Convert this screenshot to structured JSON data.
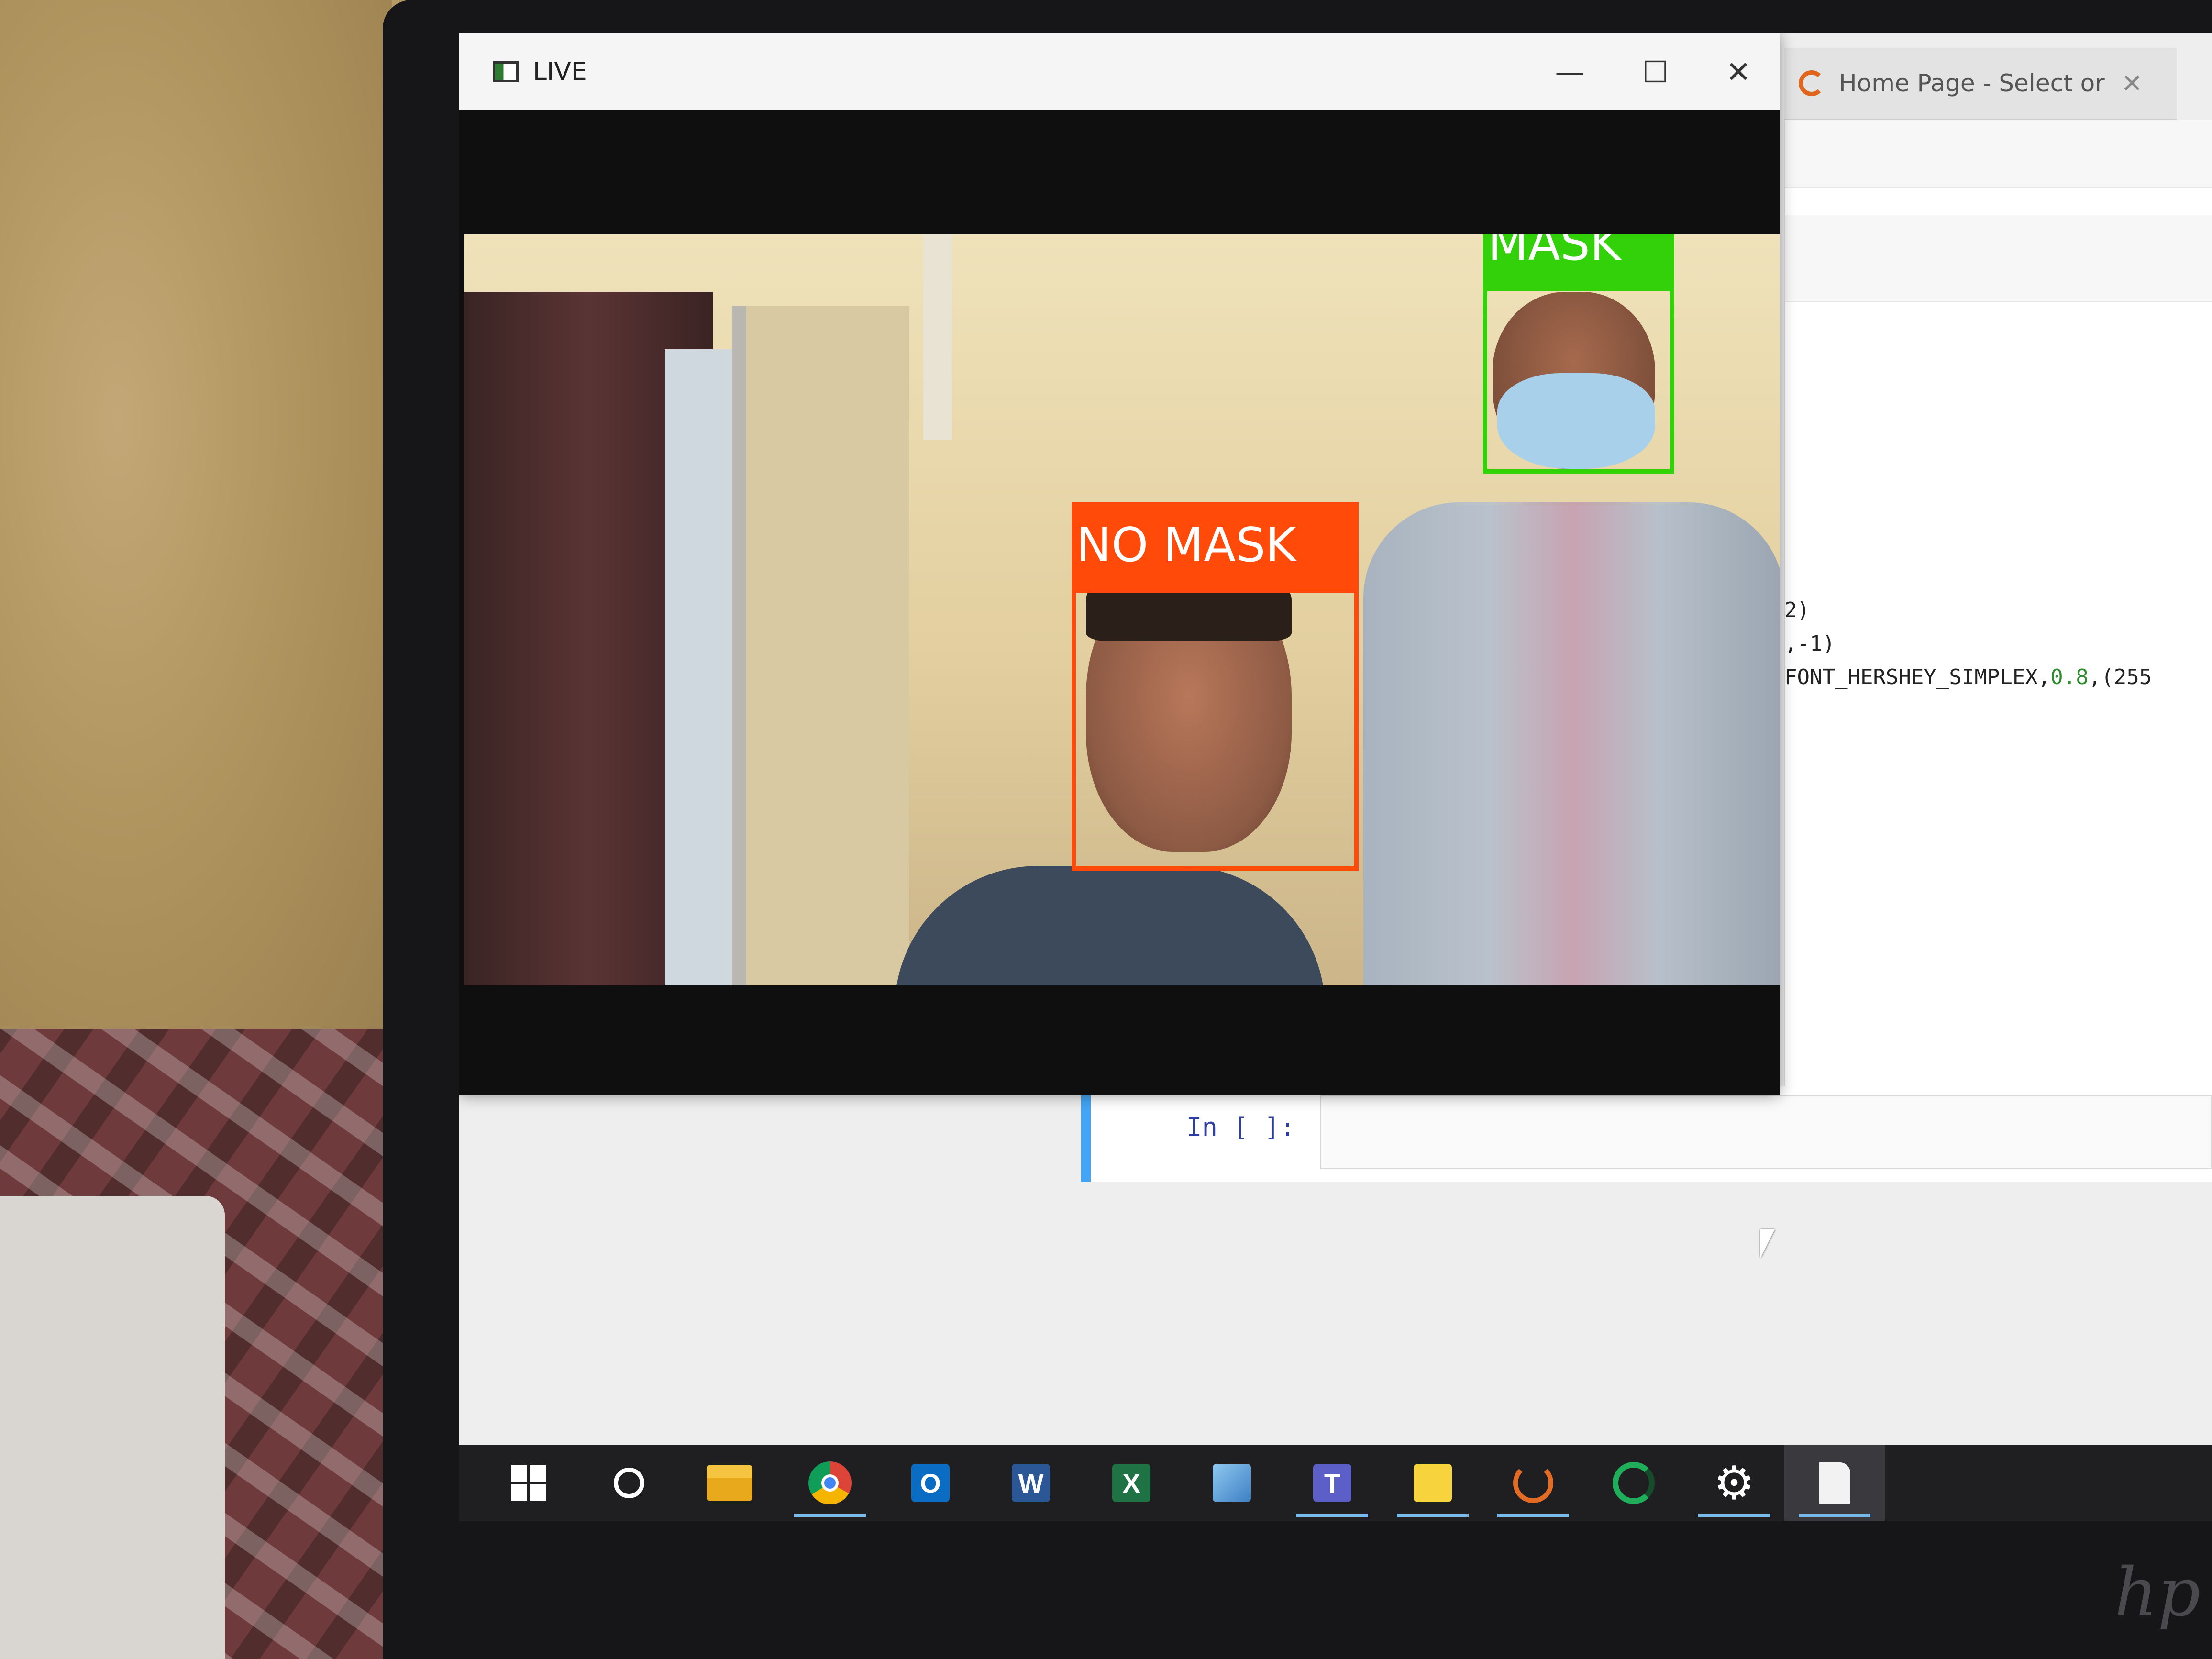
{
  "live_window": {
    "title": "LIVE",
    "controls": {
      "minimize": "—",
      "maximize": "☐",
      "close": "✕"
    }
  },
  "detections": [
    {
      "label": "NO MASK",
      "color": "#ff4a0a"
    },
    {
      "label": "MASK",
      "color": "#33d10a"
    }
  ],
  "browser_tab": {
    "title": "Home Page - Select or cre",
    "close": "✕"
  },
  "code_fragments": {
    "line1": "2)",
    "line2": ",-1)",
    "line3_prefix": "FONT_HERSHEY_SIMPLEX,",
    "line3_num": "0.8",
    "line3_suffix": ",(255"
  },
  "notebook": {
    "prompt": "In [ ]:"
  },
  "brand": "hp",
  "taskbar": {
    "items": [
      {
        "icon": "windows-start-icon",
        "active": false
      },
      {
        "icon": "search-circle-icon",
        "active": false
      },
      {
        "icon": "file-explorer-icon",
        "active": false
      },
      {
        "icon": "chrome-icon",
        "active": true
      },
      {
        "icon": "outlook-icon",
        "active": false,
        "glyph": "O"
      },
      {
        "icon": "word-icon",
        "active": false,
        "glyph": "W"
      },
      {
        "icon": "excel-icon",
        "active": false,
        "glyph": "X"
      },
      {
        "icon": "remote-desktop-icon",
        "active": false
      },
      {
        "icon": "teams-icon",
        "active": true,
        "glyph": "T"
      },
      {
        "icon": "sticky-notes-icon",
        "active": true
      },
      {
        "icon": "orange-ring-icon",
        "active": true
      },
      {
        "icon": "green-spinner-icon",
        "active": false
      },
      {
        "icon": "settings-gear-icon",
        "active": true,
        "glyph": "⚙"
      },
      {
        "icon": "notepad-icon",
        "active": true
      }
    ]
  }
}
